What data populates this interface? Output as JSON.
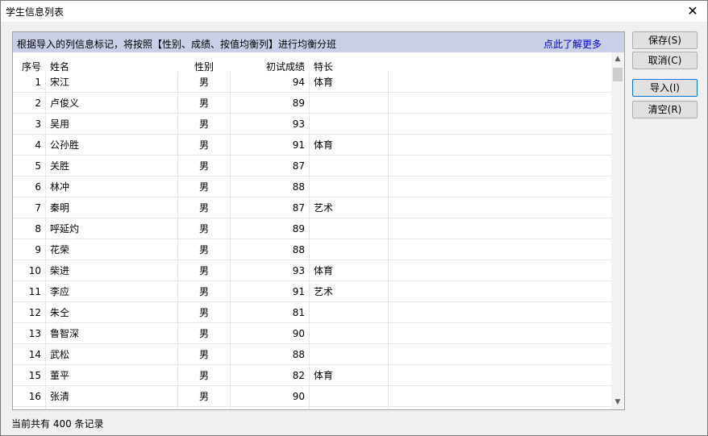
{
  "window": {
    "title": "学生信息列表"
  },
  "info_bar": {
    "text": "根据导入的列信息标记，将按照【性别、成绩、按值均衡列】进行均衡分班",
    "link": "点此了解更多"
  },
  "table": {
    "headers": [
      "序号",
      "姓名",
      "性别",
      "初试成绩",
      "特长"
    ],
    "rows": [
      [
        "1",
        "宋江",
        "男",
        "94",
        "体育"
      ],
      [
        "2",
        "卢俊义",
        "男",
        "89",
        ""
      ],
      [
        "3",
        "吴用",
        "男",
        "93",
        ""
      ],
      [
        "4",
        "公孙胜",
        "男",
        "91",
        "体育"
      ],
      [
        "5",
        "关胜",
        "男",
        "87",
        ""
      ],
      [
        "6",
        "林冲",
        "男",
        "88",
        ""
      ],
      [
        "7",
        "秦明",
        "男",
        "87",
        "艺术"
      ],
      [
        "8",
        "呼延灼",
        "男",
        "89",
        ""
      ],
      [
        "9",
        "花荣",
        "男",
        "88",
        ""
      ],
      [
        "10",
        "柴进",
        "男",
        "93",
        "体育"
      ],
      [
        "11",
        "李应",
        "男",
        "91",
        "艺术"
      ],
      [
        "12",
        "朱仝",
        "男",
        "81",
        ""
      ],
      [
        "13",
        "鲁智深",
        "男",
        "90",
        ""
      ],
      [
        "14",
        "武松",
        "男",
        "88",
        ""
      ],
      [
        "15",
        "董平",
        "男",
        "82",
        "体育"
      ],
      [
        "16",
        "张清",
        "男",
        "90",
        ""
      ]
    ]
  },
  "buttons": {
    "save": "保存(S)",
    "cancel": "取消(C)",
    "import": "导入(I)",
    "clear": "清空(R)"
  },
  "scrollbar": {
    "up": "▲",
    "down": "▼"
  },
  "close_icon": "✕",
  "status": "当前共有 400 条记录"
}
